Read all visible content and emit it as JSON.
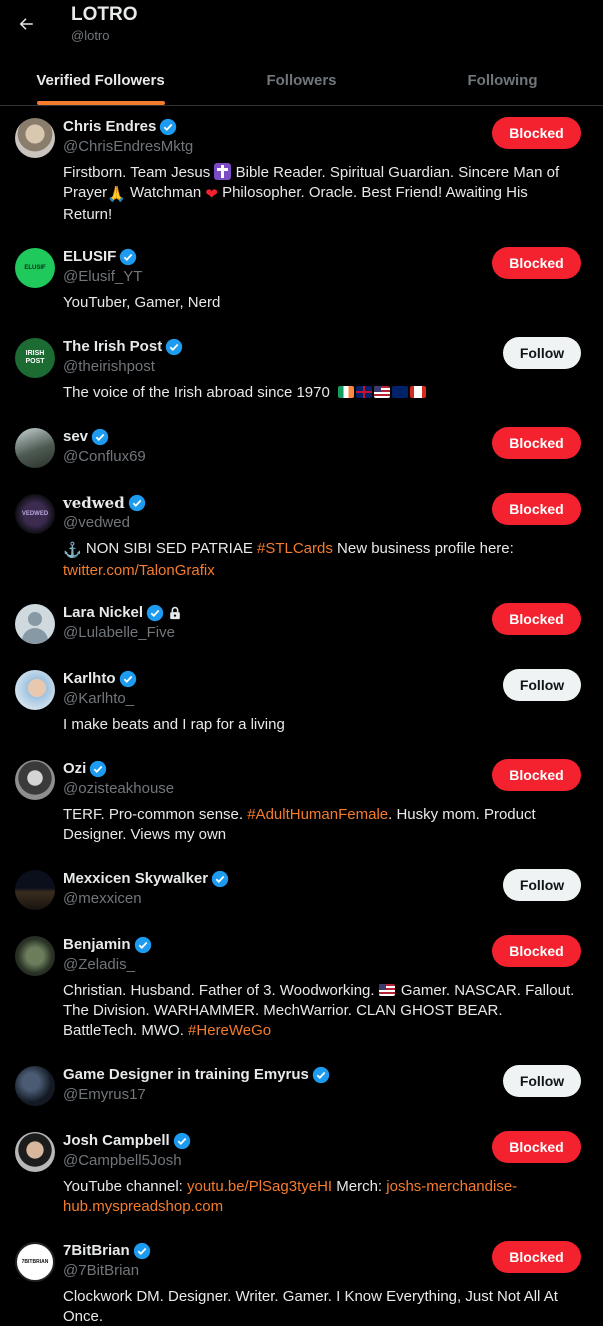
{
  "header": {
    "title": "LOTRO",
    "handle": "@lotro"
  },
  "tabs": [
    {
      "label": "Verified Followers",
      "active": true
    },
    {
      "label": "Followers",
      "active": false
    },
    {
      "label": "Following",
      "active": false
    }
  ],
  "accent": "#f57c2c",
  "users": [
    {
      "name": "Chris Endres",
      "handle": "@ChrisEndresMktg",
      "button": "Blocked",
      "avatar_icon": "bearded-man-avatar",
      "bio": [
        "Firstborn. Team Jesus ",
        " Bible Reader. Spiritual Guardian. Sincere Man of Prayer",
        " Watchman ",
        " Philosopher. Oracle. Best Friend! Awaiting His Return!"
      ]
    },
    {
      "name": "ELUSIF",
      "handle": "@Elusif_YT",
      "button": "Blocked",
      "avatar_text": "ELUSIF",
      "bio_text": "YouTuber, Gamer, Nerd"
    },
    {
      "name": "The Irish Post",
      "handle": "@theirishpost",
      "button": "Follow",
      "avatar_text": "IRISH POST",
      "bio_text": "The voice of the Irish abroad since 1970"
    },
    {
      "name": "sev",
      "handle": "@Conflux69",
      "button": "Blocked",
      "avatar_icon": "landscape-avatar"
    },
    {
      "name": "vedwed",
      "handle": "@vedwed",
      "button": "Blocked",
      "avatar_text": "VEDWED",
      "bio_pre": " NON SIBI SED PATRIAE ",
      "bio_tag": "#STLCards",
      "bio_mid": " New business profile here: ",
      "bio_link": "twitter.com/TalonGrafix"
    },
    {
      "name": "Lara Nickel",
      "handle": "@Lulabelle_Five",
      "button": "Blocked",
      "avatar_icon": "default-avatar"
    },
    {
      "name": "Karlhto",
      "handle": "@Karlhto_",
      "button": "Follow",
      "avatar_icon": "person-avatar",
      "bio_text": "I make beats and I rap for a living"
    },
    {
      "name": "Ozi",
      "handle": "@ozisteakhouse",
      "button": "Blocked",
      "avatar_icon": "portrait-avatar",
      "bio_pre": "TERF. Pro-common sense. ",
      "bio_tag": "#AdultHumanFemale",
      "bio_post": ". Husky mom. Product Designer. Views my own"
    },
    {
      "name": "Mexxicen Skywalker",
      "handle": "@mexxicen",
      "button": "Follow",
      "avatar_icon": "night-city-avatar"
    },
    {
      "name": "Benjamin",
      "handle": "@Zeladis_",
      "button": "Blocked",
      "avatar_icon": "figure-avatar",
      "bio_pre": "Christian. Husband. Father of 3. Woodworking. ",
      "bio_mid": " Gamer. NASCAR. Fallout. The Division. WARHAMMER. MechWarrior. CLAN GHOST BEAR. BattleTech. MWO. ",
      "bio_tag": "#HereWeGo"
    },
    {
      "name": "Game Designer in training Emyrus",
      "handle": "@Emyrus17",
      "button": "Follow",
      "avatar_icon": "dark-figure-avatar"
    },
    {
      "name": "Josh Campbell",
      "handle": "@Campbell5Josh",
      "button": "Blocked",
      "avatar_icon": "man-avatar",
      "bio_pre": "YouTube channel: ",
      "bio_link": "youtu.be/PlSag3tyeHI",
      "bio_mid": " Merch: ",
      "bio_link2": "joshs-merchandise-hub.myspreadshop.com"
    },
    {
      "name": "7BitBrian",
      "handle": "@7BitBrian",
      "button": "Blocked",
      "avatar_text": "7BITBRIAN",
      "bio_text": "Clockwork DM. Designer. Writer. Gamer. I Know Everything, Just Not All At Once."
    }
  ]
}
